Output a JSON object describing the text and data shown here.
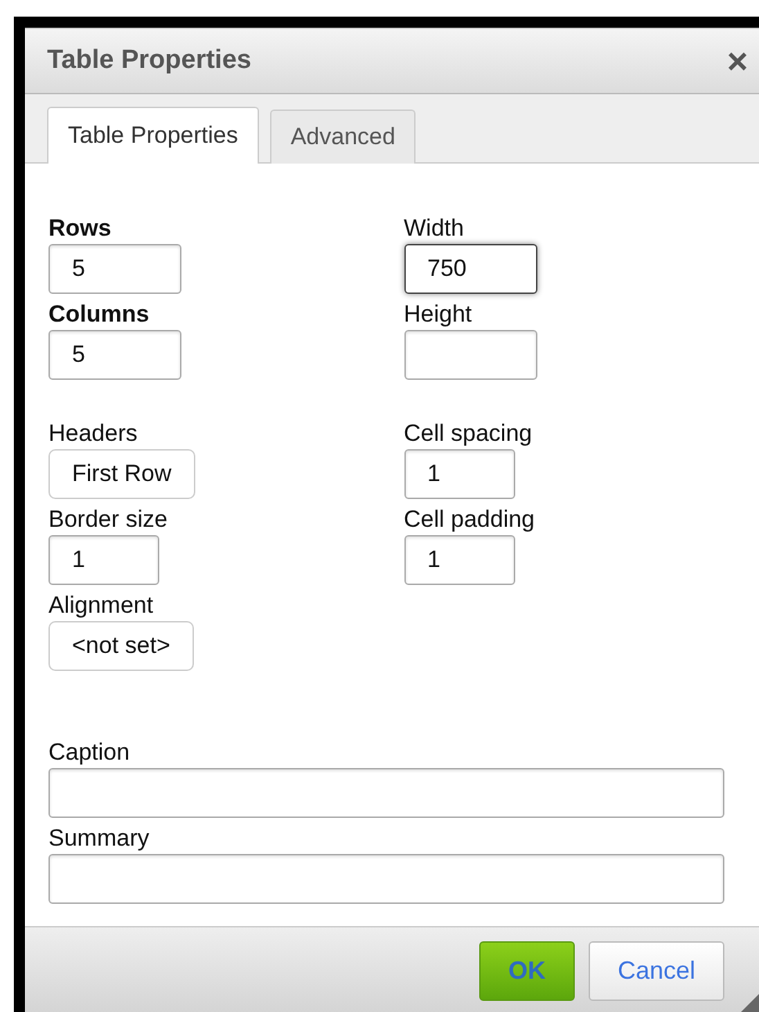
{
  "dialog": {
    "title": "Table Properties",
    "close": "×"
  },
  "tabs": [
    {
      "label": "Table Properties",
      "selected": true
    },
    {
      "label": "Advanced",
      "selected": false
    }
  ],
  "left_groups": [
    [
      {
        "label": "Rows",
        "kind": "text",
        "value": "5",
        "required": true,
        "focused": false
      },
      {
        "label": "Columns",
        "kind": "text",
        "value": "5",
        "required": true,
        "focused": false
      }
    ],
    [
      {
        "label": "Headers",
        "kind": "select",
        "value": "First Row",
        "required": false,
        "focused": false
      },
      {
        "label": "Border size",
        "kind": "text",
        "value": "1",
        "required": false,
        "focused": false
      },
      {
        "label": "Alignment",
        "kind": "select",
        "value": "<not set>",
        "required": false,
        "focused": false
      }
    ]
  ],
  "right_groups": [
    [
      {
        "label": "Width",
        "kind": "text",
        "value": "750",
        "required": false,
        "focused": true
      },
      {
        "label": "Height",
        "kind": "text",
        "required": false,
        "focused": false
      }
    ],
    [
      {
        "label": "Cell spacing",
        "kind": "text",
        "value": "1",
        "required": false,
        "focused": false
      },
      {
        "label": "Cell padding",
        "kind": "text",
        "value": "1",
        "required": false,
        "focused": false
      }
    ]
  ],
  "wide_fields": [
    {
      "label": "Caption",
      "kind": "text",
      "required": false,
      "focused": false
    },
    {
      "label": "Summary",
      "kind": "text",
      "required": false,
      "focused": false
    }
  ],
  "buttons": [
    {
      "label": "OK",
      "kind": "primary"
    },
    {
      "label": "Cancel",
      "kind": "secondary"
    }
  ]
}
